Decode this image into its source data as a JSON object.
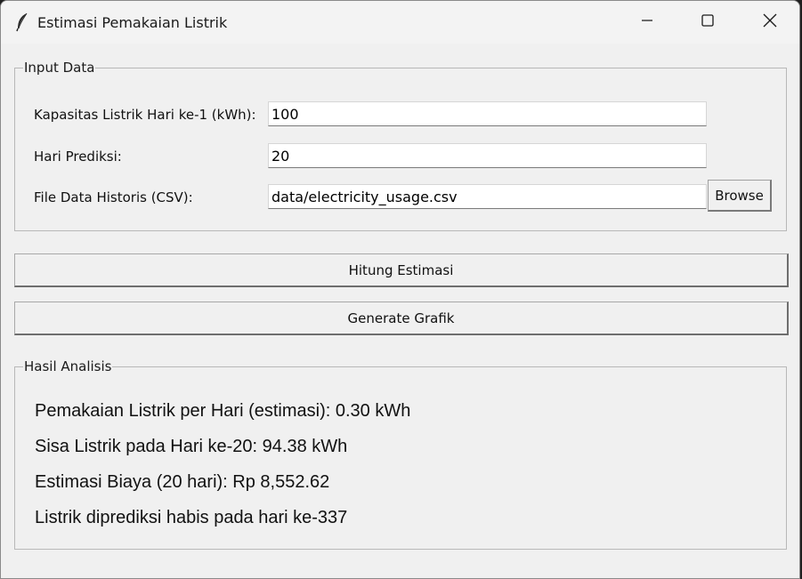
{
  "window": {
    "title": "Estimasi Pemakaian Listrik",
    "icons": {
      "app": "feather-icon",
      "minimize": "minimize-icon",
      "maximize": "maximize-icon",
      "close": "close-icon"
    }
  },
  "input_section": {
    "legend": "Input Data",
    "fields": [
      {
        "label": "Kapasitas Listrik Hari ke-1 (kWh):",
        "value": "100"
      },
      {
        "label": "Hari Prediksi:",
        "value": "20"
      },
      {
        "label": "File Data Historis (CSV):",
        "value": "data/electricity_usage.csv"
      }
    ],
    "browse_label": "Browse"
  },
  "actions": {
    "hitung_label": "Hitung Estimasi",
    "grafik_label": "Generate Grafik"
  },
  "result_section": {
    "legend": "Hasil Analisis",
    "lines": [
      "Pemakaian Listrik per Hari (estimasi): 0.30 kWh",
      "Sisa Listrik pada Hari ke-20: 94.38 kWh",
      "Estimasi Biaya (20 hari): Rp 8,552.62",
      "Listrik diprediksi habis pada hari ke-337"
    ]
  }
}
